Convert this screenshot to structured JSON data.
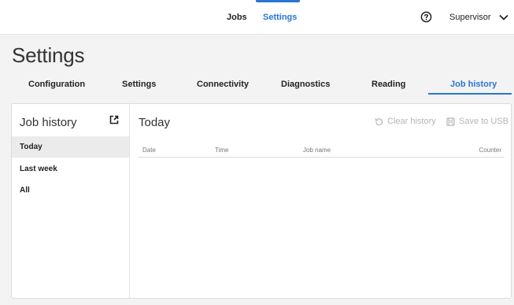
{
  "topnav": {
    "jobs": "Jobs",
    "settings": "Settings",
    "user": "Supervisor",
    "icons": [
      "help-icon",
      "chevron-down-icon"
    ]
  },
  "page": {
    "title": "Settings"
  },
  "tabs": [
    {
      "label": "Configuration"
    },
    {
      "label": "Settings"
    },
    {
      "label": "Connectivity"
    },
    {
      "label": "Diagnostics"
    },
    {
      "label": "Reading"
    },
    {
      "label": "Job history",
      "active": true
    }
  ],
  "sidebar": {
    "title": "Job history",
    "items": [
      {
        "label": "Today",
        "selected": true
      },
      {
        "label": "Last week"
      },
      {
        "label": "All"
      }
    ]
  },
  "main": {
    "title": "Today",
    "actions": {
      "clear": "Clear history",
      "save": "Save to USB"
    },
    "columns": [
      "Date",
      "Time",
      "Job name",
      "Counter"
    ],
    "rows": []
  },
  "colors": {
    "accent": "#2a76d2",
    "disabled": "#b5b5b5",
    "background": "#f3f3f3"
  }
}
